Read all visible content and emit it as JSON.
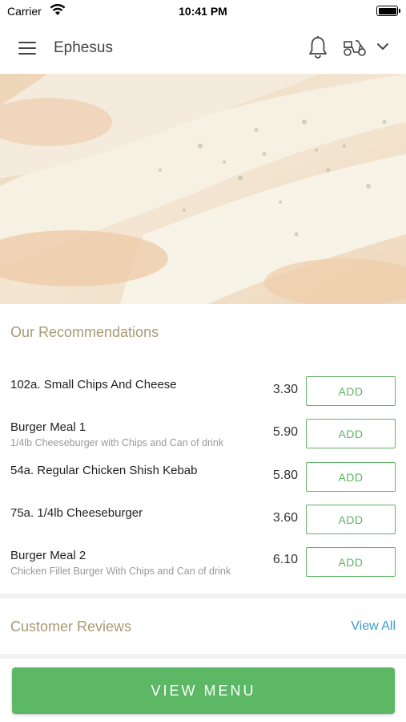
{
  "status_bar": {
    "carrier": "Carrier",
    "time": "10:41 PM"
  },
  "header": {
    "title": "Ephesus",
    "icons": [
      "menu-icon",
      "bell-icon",
      "delivery-scooter-icon",
      "chevron-down-icon"
    ]
  },
  "recommendations": {
    "title": "Our Recommendations",
    "items": [
      {
        "name": "102a. Small Chips And Cheese",
        "description": "",
        "price": "3.30",
        "button": "ADD"
      },
      {
        "name": "Burger Meal 1",
        "description": "1/4lb Cheeseburger with Chips and Can of drink",
        "price": "5.90",
        "button": "ADD"
      },
      {
        "name": "54a. Regular Chicken Shish Kebab",
        "description": "",
        "price": "5.80",
        "button": "ADD"
      },
      {
        "name": "75a. 1/4lb Cheeseburger",
        "description": "",
        "price": "3.60",
        "button": "ADD"
      },
      {
        "name": "Burger Meal 2",
        "description": "Chicken Fillet Burger With Chips and Can of drink",
        "price": "6.10",
        "button": "ADD"
      }
    ]
  },
  "reviews": {
    "title": "Customer Reviews",
    "view_all": "View All"
  },
  "footer": {
    "view_menu": "VIEW MENU"
  },
  "colors": {
    "accent_green": "#5cb865",
    "section_title": "#a89a74",
    "link_blue": "#3d9bc9"
  }
}
